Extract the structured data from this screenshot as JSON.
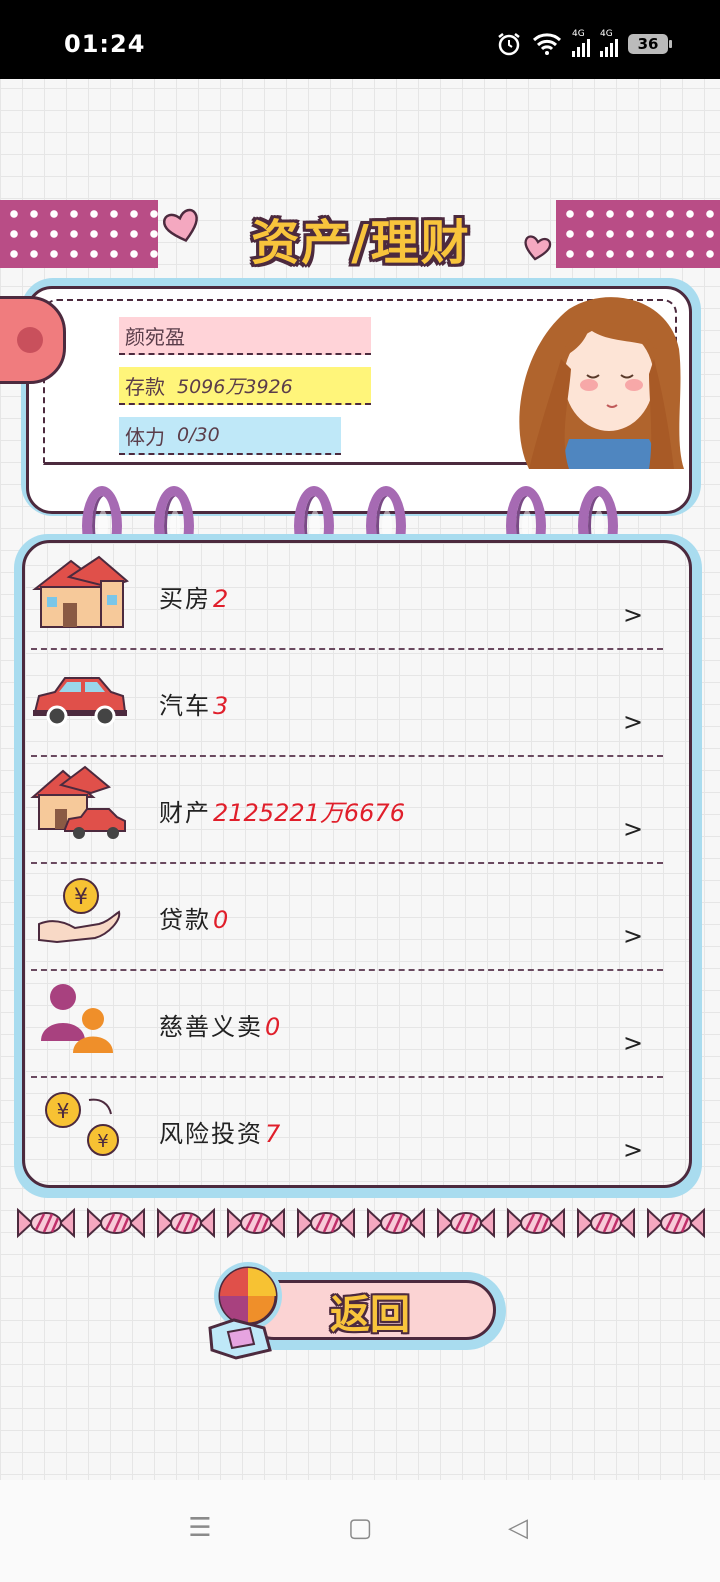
{
  "status_bar": {
    "time": "01:24",
    "network_1": "4G",
    "network_2": "4G",
    "battery": "36"
  },
  "page": {
    "title": "资产/理财",
    "return_label": "返回"
  },
  "profile": {
    "name": "颜宛盈",
    "savings_label": "存款",
    "savings_value": "5096万3926",
    "stamina_label": "体力",
    "stamina_value": "0/30"
  },
  "menu": {
    "items": [
      {
        "label": "买房",
        "value": "2",
        "icon": "house-icon"
      },
      {
        "label": "汽车",
        "value": "3",
        "icon": "car-icon"
      },
      {
        "label": "财产",
        "value": "2125221万6676",
        "icon": "property-icon"
      },
      {
        "label": "贷款",
        "value": "0",
        "icon": "loan-icon"
      },
      {
        "label": "慈善义卖",
        "value": "0",
        "icon": "charity-icon"
      },
      {
        "label": "风险投资",
        "value": "7",
        "icon": "investment-icon"
      }
    ],
    "chevron": ">"
  },
  "nav": {
    "menu": "☰",
    "home": "▢",
    "back": "◁"
  }
}
